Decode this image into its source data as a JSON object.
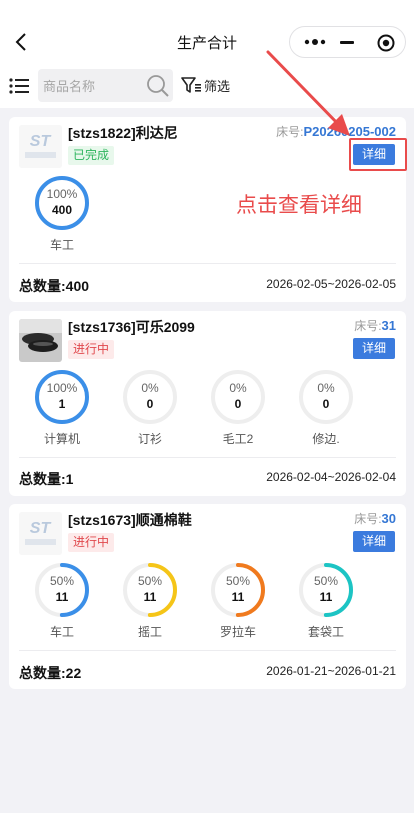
{
  "nav": {
    "title": "生产合计"
  },
  "search": {
    "placeholder": "商品名称",
    "filter_label": "筛选"
  },
  "annotation": {
    "text": "点击查看详细",
    "color": "#e94b4b"
  },
  "colors": {
    "accent": "#3b7bde",
    "done_text": "#2db55d",
    "doing_text": "#e0484c",
    "ring_blue": "#3b8fe8",
    "ring_yellow": "#f5c518",
    "ring_orange": "#f07a1e",
    "ring_teal": "#1cc4c4",
    "ring_track": "#eeeeee"
  },
  "orders": [
    {
      "title": "[stzs1822]利达尼",
      "bed_label": "床号:",
      "bed_no": "P20260205-002",
      "status": "已完成",
      "detail_label": "详细",
      "thumb": "logo",
      "processes": [
        {
          "name": "车工",
          "percent": "100%",
          "qty": "400",
          "progress": 1.0,
          "color": "#3b8fe8"
        }
      ],
      "total_label": "总数量:400",
      "date_range": "2026-02-05~2026-02-05"
    },
    {
      "title": "[stzs1736]可乐2099",
      "bed_label": "床号:",
      "bed_no": "31",
      "status": "进行中",
      "detail_label": "详细",
      "thumb": "shoe-photo",
      "processes": [
        {
          "name": "计算机",
          "percent": "100%",
          "qty": "1",
          "progress": 1.0,
          "color": "#3b8fe8"
        },
        {
          "name": "订衫",
          "percent": "0%",
          "qty": "0",
          "progress": 0.0,
          "color": "#3b8fe8"
        },
        {
          "name": "毛工2",
          "percent": "0%",
          "qty": "0",
          "progress": 0.0,
          "color": "#3b8fe8"
        },
        {
          "name": "修边.",
          "percent": "0%",
          "qty": "0",
          "progress": 0.0,
          "color": "#3b8fe8"
        }
      ],
      "total_label": "总数量:1",
      "date_range": "2026-02-04~2026-02-04"
    },
    {
      "title": "[stzs1673]顺通棉鞋",
      "bed_label": "床号:",
      "bed_no": "30",
      "status": "进行中",
      "detail_label": "详细",
      "thumb": "logo",
      "processes": [
        {
          "name": "车工",
          "percent": "50%",
          "qty": "11",
          "progress": 0.5,
          "color": "#3b8fe8"
        },
        {
          "name": "摇工",
          "percent": "50%",
          "qty": "11",
          "progress": 0.5,
          "color": "#f5c518"
        },
        {
          "name": "罗拉车",
          "percent": "50%",
          "qty": "11",
          "progress": 0.5,
          "color": "#f07a1e"
        },
        {
          "name": "套袋工",
          "percent": "50%",
          "qty": "11",
          "progress": 0.5,
          "color": "#1cc4c4"
        }
      ],
      "total_label": "总数量:22",
      "date_range": "2026-01-21~2026-01-21"
    }
  ]
}
